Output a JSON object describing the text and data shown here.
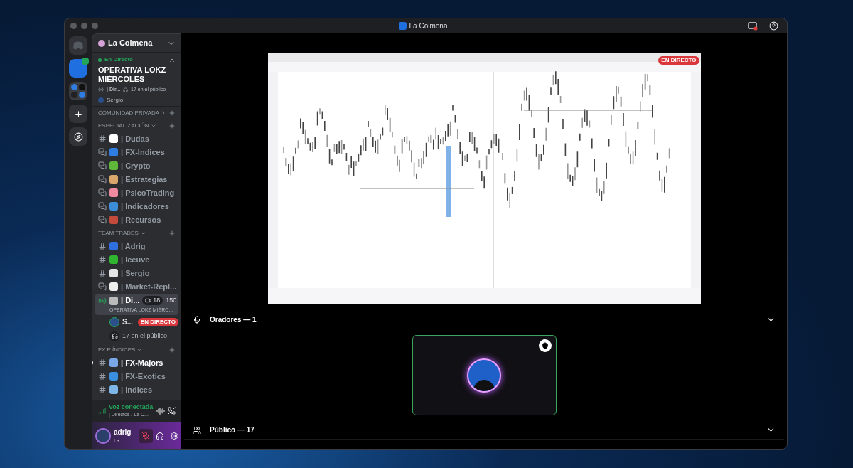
{
  "window": {
    "title": "La Colmena"
  },
  "server": {
    "name": "La Colmena"
  },
  "live_panel": {
    "status": "En Directo",
    "title": "OPERATIVA LOKZ MIÉRCOLES",
    "channel": "| Dir...",
    "audience": "17 en el público",
    "host": "Sergio"
  },
  "categories": [
    {
      "name": "COMUNIDAD PRIVADA",
      "expanded": false
    },
    {
      "name": "ESPECIALIZACIÓN",
      "expanded": true,
      "channels": [
        {
          "kind": "text",
          "color": "#ffffff",
          "name": "| Dudas",
          "unread": false
        },
        {
          "kind": "forum",
          "color": "#2f7de1",
          "name": "| FX-Indices",
          "unread": false
        },
        {
          "kind": "forum",
          "color": "#5fb83a",
          "name": "| Crypto",
          "unread": false
        },
        {
          "kind": "forum",
          "color": "#d9a66b",
          "name": "| Estrategias",
          "unread": false
        },
        {
          "kind": "forum",
          "color": "#f08aa0",
          "name": "| PsicoTrading",
          "unread": false
        },
        {
          "kind": "forum",
          "color": "#3c8ed8",
          "name": "| Indicadores",
          "unread": false
        },
        {
          "kind": "forum",
          "color": "#c44b3b",
          "name": "| Recursos",
          "unread": false
        }
      ]
    },
    {
      "name": "TEAM TRADES",
      "expanded": true,
      "channels": [
        {
          "kind": "text",
          "color": "#2f6fe0",
          "name": "| Adrig",
          "unread": false
        },
        {
          "kind": "text",
          "color": "#2fb52f",
          "name": "| Iceuve",
          "unread": false
        },
        {
          "kind": "text",
          "color": "#e5e5e5",
          "name": "| Sergio",
          "unread": false
        },
        {
          "kind": "forum",
          "color": "#eeeeee",
          "name": "| Market-Repl...",
          "unread": false
        },
        {
          "kind": "stage",
          "color": "#bbbbbb",
          "name": "| Di...",
          "selected": true,
          "video_count": "18",
          "listeners": "150",
          "subtitle": "OPERATIVA LOKZ MIÉRC...",
          "children": [
            {
              "kind": "speaker",
              "name": "S...",
              "badge": "EN DIRECTO"
            },
            {
              "kind": "audience",
              "name": "17 en el público"
            }
          ]
        }
      ]
    },
    {
      "name": "FX E ÍNDICES",
      "expanded": true,
      "channels": [
        {
          "kind": "text",
          "color": "#7aa7e8",
          "name": "| FX-Majors",
          "unread": true
        },
        {
          "kind": "text",
          "color": "#3b8fe0",
          "name": "| FX-Exotics",
          "unread": false
        },
        {
          "kind": "text",
          "color": "#7fb6e8",
          "name": "| Indices",
          "unread": false
        }
      ]
    }
  ],
  "voice_panel": {
    "status": "Voz conectada",
    "channel": "| Directos / La C..."
  },
  "user_panel": {
    "name": "adrig",
    "status": "La ...",
    "mic_muted": true
  },
  "stream": {
    "badge": "EN DIRECTO"
  },
  "sections": [
    {
      "title": "Oradores — 1",
      "expanded": true
    },
    {
      "title": "Público — 17",
      "expanded": true
    }
  ],
  "speaker": {
    "speaking": true,
    "moderator": true
  }
}
